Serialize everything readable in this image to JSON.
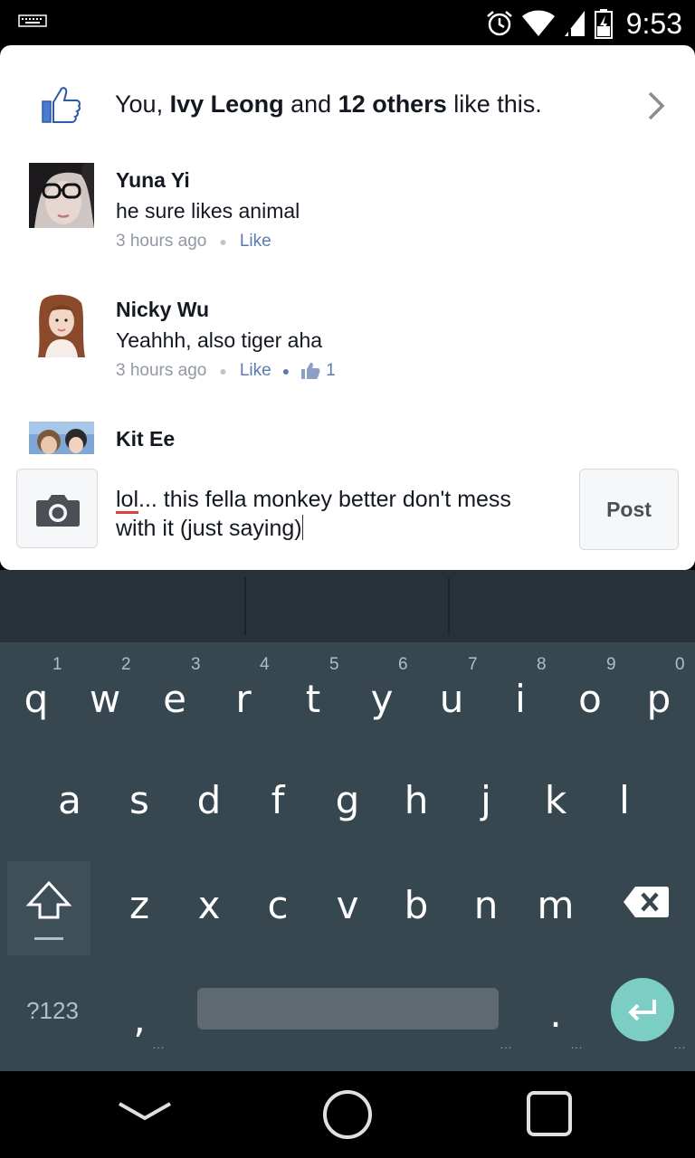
{
  "status_bar": {
    "time": "9:53",
    "icons": [
      "keyboard-icon",
      "alarm-icon",
      "wifi-icon",
      "signal-icon",
      "battery-icon"
    ]
  },
  "likes": {
    "prefix": "You, ",
    "name": "Ivy Leong",
    "middle": " and ",
    "others": "12 others",
    "suffix": " like this."
  },
  "comments": [
    {
      "name": "Yuna Yi",
      "text": "he sure likes animal",
      "time": "3 hours ago",
      "like_label": "Like",
      "like_count": ""
    },
    {
      "name": "Nicky Wu",
      "text": "Yeahhh, also tiger aha",
      "time": "3 hours ago",
      "like_label": "Like",
      "like_count": "1"
    },
    {
      "name": "Kit Ee",
      "text": "",
      "time": "",
      "like_label": "",
      "like_count": ""
    }
  ],
  "composer": {
    "text_misspelled": "lol",
    "text_rest_line1": "... this fella monkey better don't mess",
    "text_line2": "with it (just saying)",
    "post_label": "Post"
  },
  "keyboard": {
    "row1": [
      {
        "key": "q",
        "hint": "1"
      },
      {
        "key": "w",
        "hint": "2"
      },
      {
        "key": "e",
        "hint": "3"
      },
      {
        "key": "r",
        "hint": "4"
      },
      {
        "key": "t",
        "hint": "5"
      },
      {
        "key": "y",
        "hint": "6"
      },
      {
        "key": "u",
        "hint": "7"
      },
      {
        "key": "i",
        "hint": "8"
      },
      {
        "key": "o",
        "hint": "9"
      },
      {
        "key": "p",
        "hint": "0"
      }
    ],
    "row2": [
      "a",
      "s",
      "d",
      "f",
      "g",
      "h",
      "j",
      "k",
      "l"
    ],
    "row3": [
      "z",
      "x",
      "c",
      "v",
      "b",
      "n",
      "m"
    ],
    "symbols_label": "?123",
    "comma": ",",
    "period": "."
  },
  "colors": {
    "facebook_blue": "#4267b2",
    "keyboard_bg": "#37474f",
    "suggestion_bg": "#263238",
    "enter_accent": "#7ccdc4"
  }
}
